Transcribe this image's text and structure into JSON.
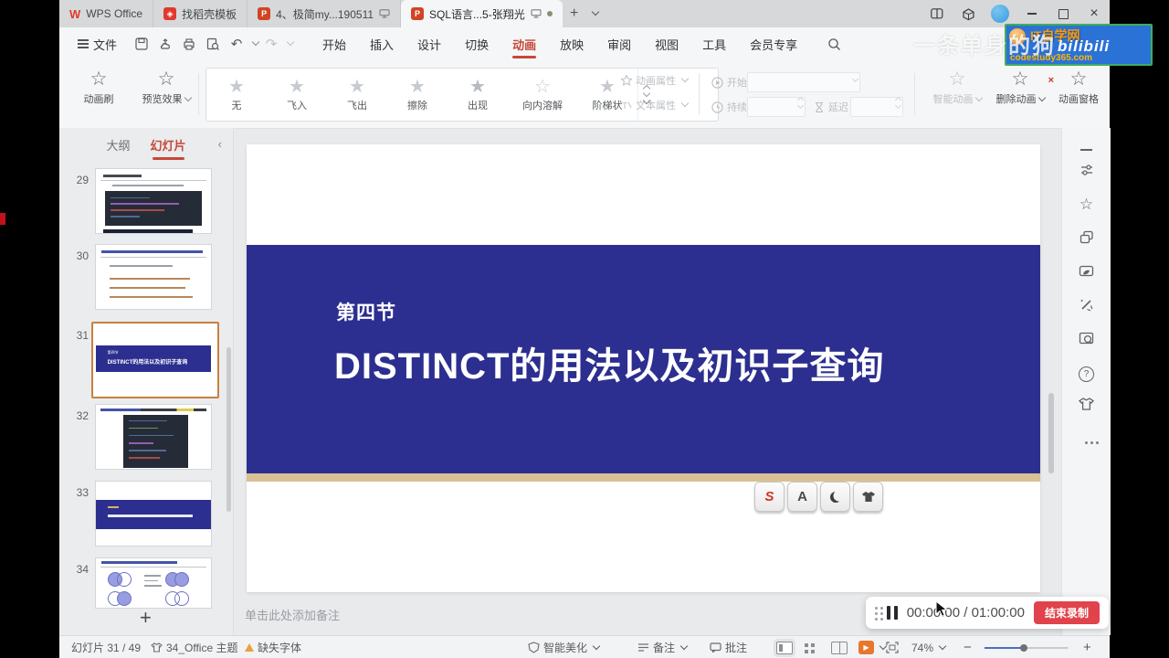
{
  "window": {
    "tabs": [
      {
        "label": "WPS Office"
      },
      {
        "label": "找稻壳模板"
      },
      {
        "label": "4、极简my...190511"
      },
      {
        "label": "SQL语言...5-张翔光"
      }
    ],
    "new_tab": "+"
  },
  "menubar": {
    "file": "文件",
    "menus": [
      "开始",
      "插入",
      "设计",
      "切换",
      "动画",
      "放映",
      "审阅",
      "视图",
      "工具",
      "会员专享"
    ],
    "active": "动画"
  },
  "ribbon": {
    "animation_brush": "动画刷",
    "preview": "预览效果",
    "gallery": [
      "无",
      "飞入",
      "飞出",
      "擦除",
      "出现",
      "向内溶解",
      "阶梯状"
    ],
    "animation_props": "动画属性",
    "text_props": "文本属性",
    "start": "开始",
    "duration": "持续",
    "delay": "延迟",
    "smart_animation": "智能动画",
    "delete_animation": "删除动画",
    "animation_pane": "动画窗格"
  },
  "sidebar": {
    "outline_tab": "大纲",
    "slides_tab": "幻灯片",
    "selected_slide": "31",
    "thumbs": [
      {
        "num": "29"
      },
      {
        "num": "30"
      },
      {
        "num": "31"
      },
      {
        "num": "32"
      },
      {
        "num": "33"
      },
      {
        "num": "34"
      }
    ],
    "add": "+"
  },
  "slide": {
    "section": "第四节",
    "title": "DISTINCT的用法以及初识子查询"
  },
  "notes": {
    "placeholder": "单击此处添加备注"
  },
  "recording": {
    "time": "00:00:00 / 01:00:00",
    "stop": "结束录制"
  },
  "statusbar": {
    "slide_info": "幻灯片 31 / 49",
    "theme": "34_Office 主题",
    "missing_font": "缺失字体",
    "beautify": "智能美化",
    "notes": "备注",
    "comments": "批注",
    "zoom": "74%",
    "zoom_out": "−",
    "zoom_in": "+"
  },
  "overlay": {
    "watermark": "一条单身的狗",
    "badge_line1": "IT自学网",
    "badge_line2": "bilibili",
    "badge_line3": "codestudy365.com"
  },
  "icons": {
    "rightbar": [
      "collapse",
      "properties",
      "animation-effects",
      "layers",
      "assets",
      "tools",
      "image-search",
      "help",
      "theme",
      "more"
    ],
    "keycaps": [
      "s-key",
      "a-key",
      "moon-key",
      "shirt-key"
    ]
  },
  "colors": {
    "accent_orange": "#c5483b",
    "slide_blue": "#2c2f8f",
    "tan_stripe": "#d9c095",
    "record_red": "#e0434c",
    "play_orange": "#e8772e"
  }
}
